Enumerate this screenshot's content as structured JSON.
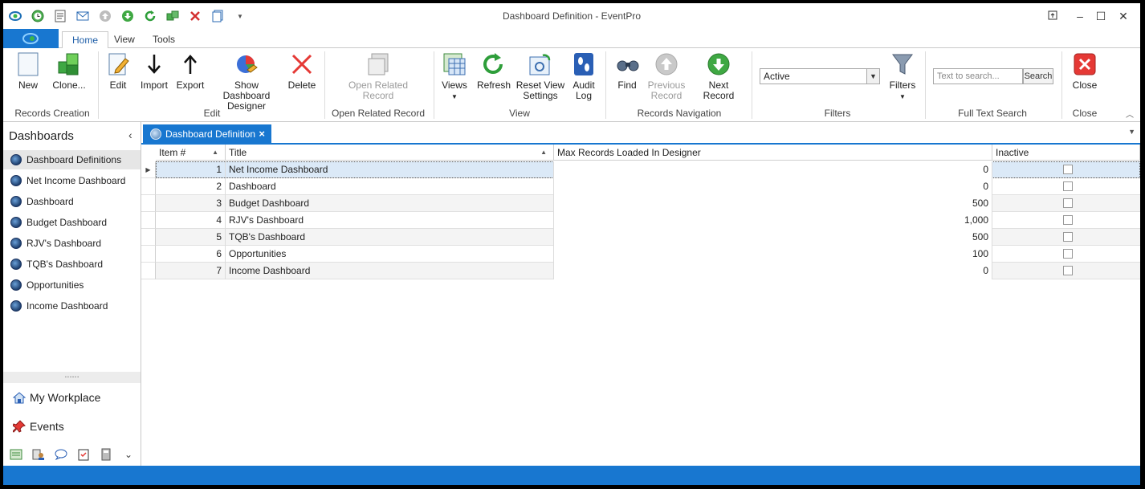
{
  "window": {
    "title": "Dashboard Definition - EventPro"
  },
  "colors": {
    "accent": "#1877d0",
    "selected_row": "#dbe9f7"
  },
  "quick_access": [
    "eventpro-logo-icon",
    "clock-icon",
    "document-icon",
    "mail-icon",
    "up-arrow-icon",
    "down-arrow-icon",
    "refresh-icon",
    "add-icon",
    "delete-icon",
    "copy-icon",
    "customize-dropdown-icon"
  ],
  "menu": {
    "tabs": [
      {
        "label": "Home"
      },
      {
        "label": "View"
      },
      {
        "label": "Tools"
      }
    ]
  },
  "ribbon": {
    "new": "New",
    "clone": "Clone...",
    "edit": "Edit",
    "import": "Import",
    "export": "Export",
    "show_dashboard_designer_1": "Show Dashboard",
    "show_dashboard_designer_2": "Designer",
    "delete": "Delete",
    "open_related_1": "Open Related",
    "open_related_2": "Record",
    "views": "Views",
    "refresh": "Refresh",
    "reset_view_1": "Reset View",
    "reset_view_2": "Settings",
    "audit_log_1": "Audit",
    "audit_log_2": "Log",
    "find": "Find",
    "previous_record_1": "Previous",
    "previous_record_2": "Record",
    "next_record": "Next Record",
    "filter_value": "Active",
    "filters": "Filters",
    "search_placeholder": "Text to search...",
    "search_button": "Search",
    "close": "Close",
    "groups": {
      "records_creation": "Records Creation",
      "edit": "Edit",
      "open_related_record": "Open Related Record",
      "view": "View",
      "records_navigation": "Records Navigation",
      "filters": "Filters",
      "full_text_search": "Full Text Search",
      "close": "Close"
    }
  },
  "sidebar": {
    "title": "Dashboards",
    "items": [
      {
        "label": "Dashboard Definitions"
      },
      {
        "label": "Net Income Dashboard"
      },
      {
        "label": "Dashboard"
      },
      {
        "label": "Budget Dashboard"
      },
      {
        "label": "RJV's Dashboard"
      },
      {
        "label": "TQB's Dashboard"
      },
      {
        "label": "Opportunities"
      },
      {
        "label": "Income Dashboard"
      }
    ],
    "nav": [
      {
        "label": "My Workplace"
      },
      {
        "label": "Events"
      }
    ]
  },
  "doc_tab": {
    "label": "Dashboard Definition"
  },
  "grid": {
    "columns": [
      "Item #",
      "Title",
      "Max Records Loaded In Designer",
      "Inactive"
    ],
    "rows": [
      {
        "item": "1",
        "title": "Net Income Dashboard",
        "max": "0",
        "inactive": false
      },
      {
        "item": "2",
        "title": "Dashboard",
        "max": "0",
        "inactive": false
      },
      {
        "item": "3",
        "title": "Budget Dashboard",
        "max": "500",
        "inactive": false
      },
      {
        "item": "4",
        "title": "RJV's Dashboard",
        "max": "1,000",
        "inactive": false
      },
      {
        "item": "5",
        "title": "TQB's Dashboard",
        "max": "500",
        "inactive": false
      },
      {
        "item": "6",
        "title": "Opportunities",
        "max": "100",
        "inactive": false
      },
      {
        "item": "7",
        "title": "Income Dashboard",
        "max": "0",
        "inactive": false
      }
    ]
  }
}
